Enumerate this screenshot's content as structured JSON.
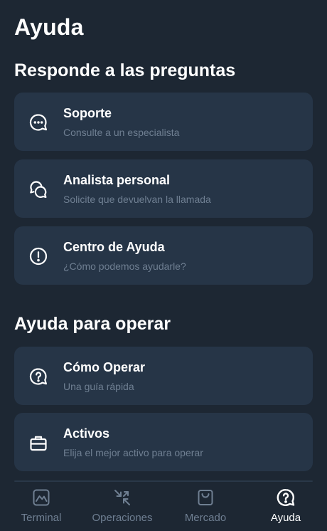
{
  "header": {
    "title": "Ayuda"
  },
  "sections": [
    {
      "title": "Responde a las preguntas",
      "items": [
        {
          "icon": "chat-dots-icon",
          "title": "Soporte",
          "subtitle": "Consulte a un especialista"
        },
        {
          "icon": "two-chat-bubbles-icon",
          "title": "Analista personal",
          "subtitle": "Solicite que devuelvan la llamada"
        },
        {
          "icon": "exclamation-circle-icon",
          "title": "Centro de Ayuda",
          "subtitle": "¿Cómo podemos ayudarle?"
        }
      ]
    },
    {
      "title": "Ayuda para operar",
      "items": [
        {
          "icon": "question-bubble-icon",
          "title": "Cómo Operar",
          "subtitle": "Una guía rápida"
        },
        {
          "icon": "briefcase-icon",
          "title": "Activos",
          "subtitle": "Elija el mejor activo para operar"
        }
      ]
    }
  ],
  "tabbar": {
    "active": "Ayuda",
    "tabs": [
      {
        "icon": "chart-terminal-icon",
        "label": "Terminal"
      },
      {
        "icon": "arrows-exchange-icon",
        "label": "Operaciones"
      },
      {
        "icon": "shopping-bag-icon",
        "label": "Mercado"
      },
      {
        "icon": "help-question-icon",
        "label": "Ayuda"
      }
    ]
  },
  "colors": {
    "background": "#1d2733",
    "card": "#263547",
    "subtitle": "#6f7f92",
    "active": "#ffffff"
  }
}
